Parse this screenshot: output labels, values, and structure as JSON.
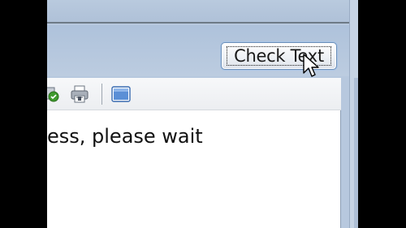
{
  "toolbar": {
    "icons": [
      "save-green-icon",
      "print-icon",
      "window-view-icon"
    ]
  },
  "check_button": {
    "label": "Check Text"
  },
  "editor": {
    "visible_text": "ess, please wait"
  },
  "colors": {
    "frame_blue": "#b7c8de",
    "button_border": "#6c8fb8",
    "letterbox": "#000000",
    "editor_background": "#ffffff"
  }
}
